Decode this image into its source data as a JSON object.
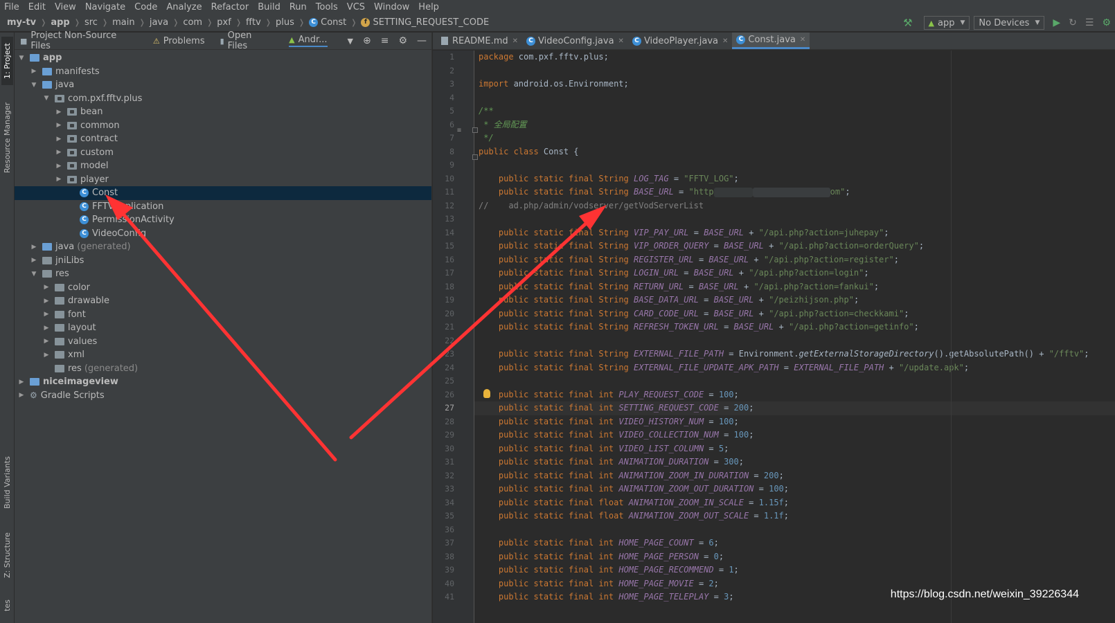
{
  "menu": [
    "File",
    "Edit",
    "View",
    "Navigate",
    "Code",
    "Analyze",
    "Refactor",
    "Build",
    "Run",
    "Tools",
    "VCS",
    "Window",
    "Help"
  ],
  "breadcrumb": {
    "items": [
      "my-tv",
      "app",
      "src",
      "main",
      "java",
      "com",
      "pxf",
      "fftv",
      "plus"
    ],
    "class": "Const",
    "field": "SETTING_REQUEST_CODE"
  },
  "toolbar": {
    "run_config": "app",
    "device": "No Devices"
  },
  "left_stripe": {
    "project": "1: Project",
    "resource_manager": "Resource Manager",
    "build_variants": "Build Variants",
    "structure": "Z: Structure",
    "favorites": "tes"
  },
  "project_panel": {
    "tabs": [
      "Project Non-Source Files",
      "Problems",
      "Open Files",
      "Andr..."
    ],
    "tree": [
      {
        "label": "app",
        "depth": 0,
        "type": "module",
        "expanded": true
      },
      {
        "label": "manifests",
        "depth": 1,
        "type": "folder-blue",
        "expanded": false
      },
      {
        "label": "java",
        "depth": 1,
        "type": "folder-blue",
        "expanded": true
      },
      {
        "label": "com.pxf.fftv.plus",
        "depth": 2,
        "type": "package",
        "expanded": true
      },
      {
        "label": "bean",
        "depth": 3,
        "type": "package",
        "expanded": false
      },
      {
        "label": "common",
        "depth": 3,
        "type": "package",
        "expanded": false
      },
      {
        "label": "contract",
        "depth": 3,
        "type": "package",
        "expanded": false
      },
      {
        "label": "custom",
        "depth": 3,
        "type": "package",
        "expanded": false
      },
      {
        "label": "model",
        "depth": 3,
        "type": "package",
        "expanded": false
      },
      {
        "label": "player",
        "depth": 3,
        "type": "package",
        "expanded": false
      },
      {
        "label": "Const",
        "depth": 4,
        "type": "class",
        "selected": true
      },
      {
        "label": "FFTVApplication",
        "depth": 4,
        "type": "class"
      },
      {
        "label": "PermissionActivity",
        "depth": 4,
        "type": "class"
      },
      {
        "label": "VideoConfig",
        "depth": 4,
        "type": "class"
      },
      {
        "label": "java",
        "muted": "(generated)",
        "depth": 1,
        "type": "folder-blue",
        "expanded": false
      },
      {
        "label": "jniLibs",
        "depth": 1,
        "type": "folder",
        "expanded": false
      },
      {
        "label": "res",
        "depth": 1,
        "type": "folder",
        "expanded": true
      },
      {
        "label": "color",
        "depth": 2,
        "type": "folder",
        "expanded": false
      },
      {
        "label": "drawable",
        "depth": 2,
        "type": "folder",
        "expanded": false
      },
      {
        "label": "font",
        "depth": 2,
        "type": "folder",
        "expanded": false
      },
      {
        "label": "layout",
        "depth": 2,
        "type": "folder",
        "expanded": false
      },
      {
        "label": "values",
        "depth": 2,
        "type": "folder",
        "expanded": false
      },
      {
        "label": "xml",
        "depth": 2,
        "type": "folder",
        "expanded": false
      },
      {
        "label": "res",
        "muted": "(generated)",
        "depth": 2,
        "type": "folder",
        "leaf": true
      },
      {
        "label": "niceimageview",
        "depth": 0,
        "type": "module",
        "expanded": false
      },
      {
        "label": "Gradle Scripts",
        "depth": 0,
        "type": "gradle",
        "expanded": false
      }
    ]
  },
  "editor": {
    "tabs": [
      {
        "label": "README.md",
        "icon": "markdown",
        "active": false
      },
      {
        "label": "VideoConfig.java",
        "icon": "class",
        "active": false
      },
      {
        "label": "VideoPlayer.java",
        "icon": "class",
        "active": false
      },
      {
        "label": "Const.java",
        "icon": "class",
        "active": true
      }
    ],
    "current_line": 27,
    "line_numbers": [
      "1",
      "2",
      "3",
      "4",
      "5",
      "6",
      "7",
      "8",
      "9",
      "10",
      "11",
      "12",
      "13",
      "14",
      "15",
      "16",
      "17",
      "18",
      "19",
      "20",
      "21",
      "22",
      "23",
      "24",
      "25",
      "26",
      "27",
      "28",
      "29",
      "30",
      "31",
      "32",
      "33",
      "34",
      "35",
      "36",
      "37",
      "38",
      "39",
      "40",
      "41"
    ],
    "code": {
      "l1": {
        "kw": "package",
        "rest": " com.pxf.fftv.plus;"
      },
      "l3": {
        "kw": "import",
        "rest": " android.os.Environment;"
      },
      "l5": "/**",
      "l6": " * 全局配置",
      "l7": " */",
      "l8": {
        "kw": "public class",
        "rest": " Const {"
      },
      "l10": {
        "field": "LOG_TAG",
        "value": "\"FFTV_LOG\""
      },
      "l11": {
        "field": "BASE_URL",
        "value_a": "\"http",
        "value_b": "om\""
      },
      "l12": {
        "comment": "//    ad.php/admin/vodserver/getVodServerList"
      },
      "string_rows": [
        {
          "line": 14,
          "field": "VIP_PAY_URL",
          "value": "\"/api.php?action=juhepay\""
        },
        {
          "line": 15,
          "field": "VIP_ORDER_QUERY",
          "value": "\"/api.php?action=orderQuery\""
        },
        {
          "line": 16,
          "field": "REGISTER_URL",
          "value": "\"/api.php?action=register\""
        },
        {
          "line": 17,
          "field": "LOGIN_URL",
          "value": "\"/api.php?action=login\""
        },
        {
          "line": 18,
          "field": "RETURN_URL",
          "value": "\"/api.php?action=fankui\""
        },
        {
          "line": 19,
          "field": "BASE_DATA_URL",
          "value": "\"/peizhijson.php\""
        },
        {
          "line": 20,
          "field": "CARD_CODE_URL",
          "value": "\"/api.php?action=checkkami\""
        },
        {
          "line": 21,
          "field": "REFRESH_TOKEN_URL",
          "value": "\"/api.php?action=getinfo\""
        }
      ],
      "l23": {
        "field": "EXTERNAL_FILE_PATH",
        "expr_a": "Environment.",
        "method": "getExternalStorageDirectory",
        "expr_b": "().getAbsolutePath() + ",
        "value": "\"/fftv\""
      },
      "l24": {
        "field": "EXTERNAL_FILE_UPDATE_APK_PATH",
        "ref": "EXTERNAL_FILE_PATH",
        "value": "\"/update.apk\""
      },
      "int_rows": [
        {
          "line": 26,
          "type": "int",
          "field": "PLAY_REQUEST_CODE",
          "value": "100"
        },
        {
          "line": 27,
          "type": "int",
          "field": "SETTING_REQUEST_CODE",
          "value": "200"
        },
        {
          "line": 28,
          "type": "int",
          "field": "VIDEO_HISTORY_NUM",
          "value": "100"
        },
        {
          "line": 29,
          "type": "int",
          "field": "VIDEO_COLLECTION_NUM",
          "value": "100"
        },
        {
          "line": 30,
          "type": "int",
          "field": "VIDEO_LIST_COLUMN",
          "value": "5"
        },
        {
          "line": 31,
          "type": "int",
          "field": "ANIMATION_DURATION",
          "value": "300"
        },
        {
          "line": 32,
          "type": "int",
          "field": "ANIMATION_ZOOM_IN_DURATION",
          "value": "200"
        },
        {
          "line": 33,
          "type": "int",
          "field": "ANIMATION_ZOOM_OUT_DURATION",
          "value": "100"
        },
        {
          "line": 34,
          "type": "float",
          "field": "ANIMATION_ZOOM_IN_SCALE",
          "value": "1.15f"
        },
        {
          "line": 35,
          "type": "float",
          "field": "ANIMATION_ZOOM_OUT_SCALE",
          "value": "1.1f"
        },
        {
          "line": 37,
          "type": "int",
          "field": "HOME_PAGE_COUNT",
          "value": "6"
        },
        {
          "line": 38,
          "type": "int",
          "field": "HOME_PAGE_PERSON",
          "value": "0"
        },
        {
          "line": 39,
          "type": "int",
          "field": "HOME_PAGE_RECOMMEND",
          "value": "1"
        },
        {
          "line": 40,
          "type": "int",
          "field": "HOME_PAGE_MOVIE",
          "value": "2"
        },
        {
          "line": 41,
          "type": "int",
          "field": "HOME_PAGE_TELEPLAY",
          "value": "3"
        }
      ],
      "modifier": "public static final",
      "string_type": "String",
      "base_ref": "BASE_URL"
    }
  },
  "watermark": "https://blog.csdn.net/weixin_39226344",
  "colors": {
    "arrow": "#ff3333",
    "selection": "#0d293e",
    "keyword": "#cc7832",
    "string": "#6a8759",
    "number": "#6897bb",
    "field": "#9876aa"
  }
}
